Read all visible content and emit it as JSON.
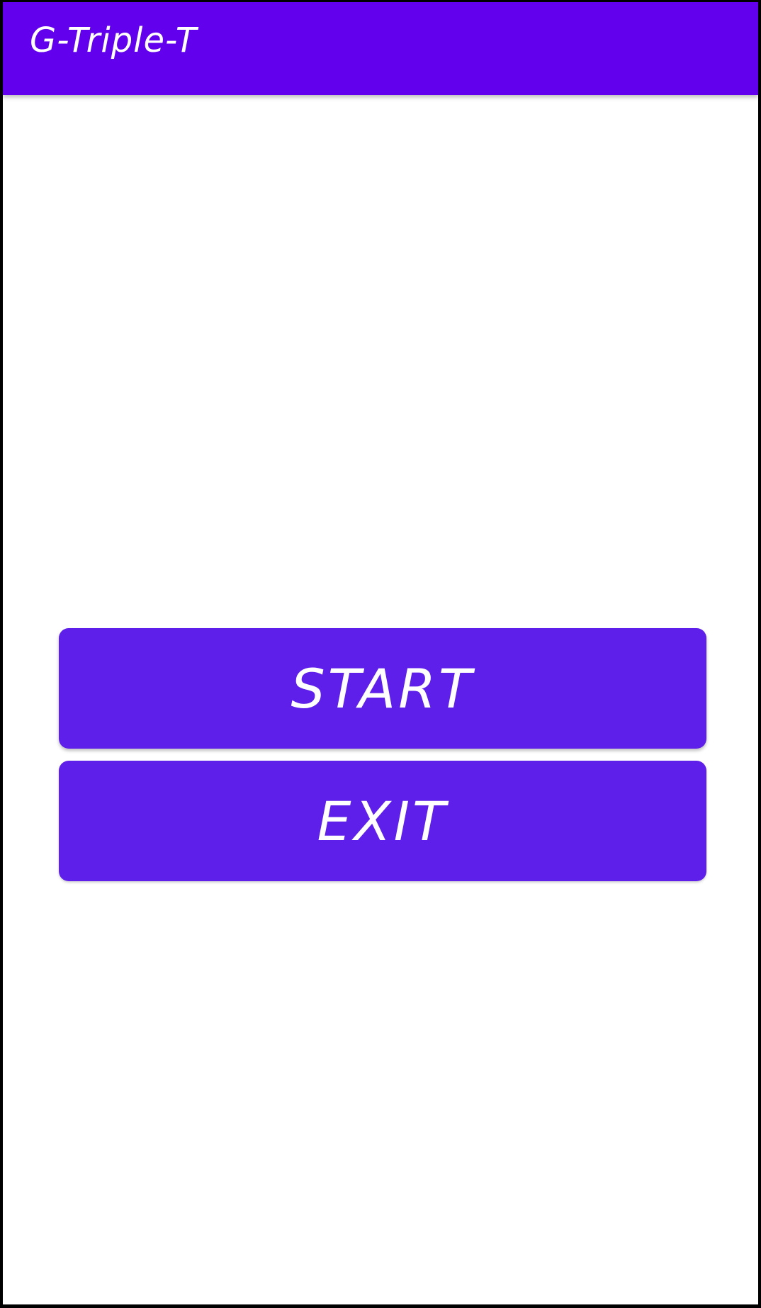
{
  "app_bar": {
    "title": "G-Triple-T",
    "color": "#6200EE"
  },
  "buttons": {
    "start_label": "START",
    "exit_label": "EXIT",
    "color": "#5E1FEA"
  }
}
